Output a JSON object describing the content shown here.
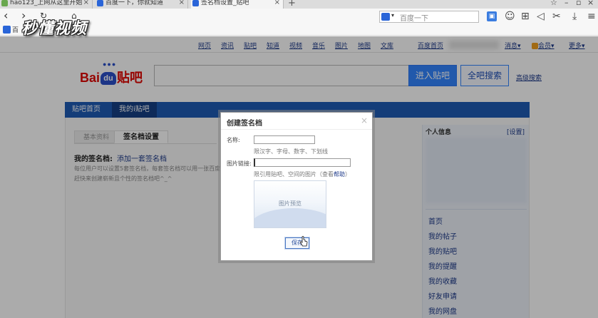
{
  "browser": {
    "tabs": [
      {
        "label": "hao123_上网从这里开始",
        "color": "#6aa84f"
      },
      {
        "label": "百度一下，你就知道",
        "color": "#2a65d8"
      },
      {
        "label": "签名档设置_贴吧",
        "color": "#2a65d8"
      }
    ],
    "search_placeholder": "百度一下",
    "search_dropdown": "▾",
    "bookmark_label": "百",
    "watermark": "秒懂视频"
  },
  "page": {
    "topnav": [
      "网页",
      "资讯",
      "贴吧",
      "知道",
      "视频",
      "音乐",
      "图片",
      "地图",
      "文库",
      "百度首页"
    ],
    "topnav_right": {
      "message": "消息",
      "member": "会员",
      "more": "更多",
      "arrow": "▾"
    },
    "logo": {
      "left": "Bai",
      "du": "du",
      "right": "贴吧"
    },
    "enter_button": "进入贴吧",
    "all_search_button": "全吧搜索",
    "advanced_search": "高级搜索",
    "bluebar_tabs": [
      "贴吧首页",
      "我的i贴吧"
    ],
    "subtabs": {
      "basic": "基本资料",
      "signature": "签名档设置"
    },
    "signature_title": "我的签名档:",
    "signature_add": "添加一套签名档",
    "signature_desc_1": "每位用户可以设置5套签名档，每套签名档可以用一张百度",
    "signature_desc_2": "赶快来创建崭新且个性的签名档吧^_^",
    "sidebar": {
      "heading": "个人信息",
      "settings": "[设置]",
      "links": [
        "首页",
        "我的帖子",
        "我的贴吧",
        "我的提醒",
        "我的收藏",
        "好友申请",
        "我的网盘"
      ]
    }
  },
  "dialog": {
    "title": "创建签名档",
    "close": "×",
    "name_label": "名称:",
    "name_hint": "限汉字、字母、数字、下划线",
    "link_label": "图片链接:",
    "link_hint_prefix": "限引用贴吧、空间的图片（",
    "link_hint_view": "查看",
    "link_help": "帮助",
    "link_hint_suffix": "）",
    "preview_text": "图片预览",
    "save_button": "保存"
  }
}
